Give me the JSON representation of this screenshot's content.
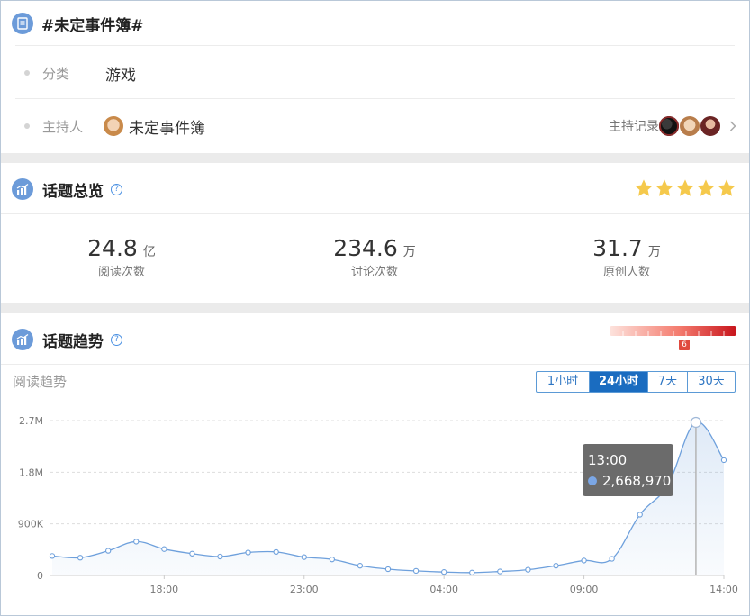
{
  "topic": {
    "title": "#未定事件簿#",
    "category_label": "分类",
    "category_value": "游戏",
    "host_label": "主持人",
    "host_name": "未定事件簿",
    "host_records_label": "主持记录"
  },
  "overview": {
    "title": "话题总览",
    "help": "?",
    "stars": 5,
    "star_color": "#f5c94c",
    "stats": [
      {
        "value": "24.8",
        "unit": "亿",
        "label": "阅读次数"
      },
      {
        "value": "234.6",
        "unit": "万",
        "label": "讨论次数"
      },
      {
        "value": "31.7",
        "unit": "万",
        "label": "原创人数"
      }
    ]
  },
  "trend": {
    "title": "话题趋势",
    "help": "?",
    "heat_level": "6",
    "subtitle": "阅读趋势",
    "tabs": [
      "1小时",
      "24小时",
      "7天",
      "30天"
    ],
    "active_tab": "24小时",
    "tooltip": {
      "time": "13:00",
      "value": "2,668,970"
    }
  },
  "chart_data": {
    "type": "area",
    "title": "",
    "xlabel": "",
    "ylabel": "",
    "x_tick_labels": [
      "18:00",
      "23:00",
      "04:00",
      "09:00",
      "14:00"
    ],
    "y_tick_labels": [
      "0",
      "900K",
      "1.8M",
      "2.7M"
    ],
    "ylim": [
      0,
      2700000
    ],
    "x": [
      "14:00",
      "15:00",
      "16:00",
      "17:00",
      "18:00",
      "19:00",
      "20:00",
      "21:00",
      "22:00",
      "23:00",
      "00:00",
      "01:00",
      "02:00",
      "03:00",
      "04:00",
      "05:00",
      "06:00",
      "07:00",
      "08:00",
      "09:00",
      "10:00",
      "11:00",
      "12:00",
      "13:00",
      "14:00"
    ],
    "series": [
      {
        "values": [
          340000,
          310000,
          430000,
          590000,
          460000,
          380000,
          330000,
          400000,
          410000,
          320000,
          280000,
          170000,
          110000,
          80000,
          60000,
          50000,
          70000,
          100000,
          170000,
          260000,
          290000,
          1060000,
          1580000,
          2668970,
          2010000
        ],
        "color": "#6ea0dc"
      }
    ],
    "highlight_index": 23,
    "grid": true
  }
}
